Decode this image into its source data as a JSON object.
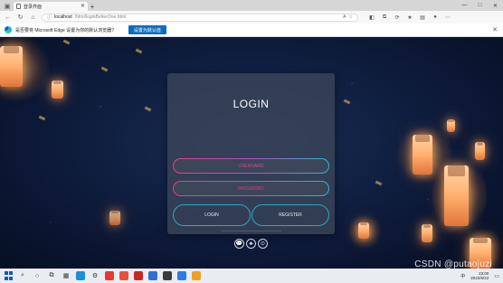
{
  "browser": {
    "tab_title": "登录界面",
    "new_tab": "+",
    "url_host": "localhost",
    "url_path": "/html/loginBetterOne.html",
    "window_controls": [
      "—",
      "□",
      "✕"
    ]
  },
  "infobar": {
    "message": "是否要将 Microsoft Edge 设置为你的默认浏览器?",
    "button": "设置为默认值"
  },
  "login": {
    "title": "LOGIN",
    "username_placeholder": "USERNAME",
    "password_placeholder": "PASSWORD",
    "login_button": "LOGIN",
    "register_button": "REGISTER",
    "social_icons": [
      "wechat-icon",
      "qq-icon",
      "github-icon"
    ]
  },
  "taskbar": {
    "time": "23:00",
    "date": "2022/6/22",
    "lang": "中"
  },
  "watermark": "CSDN @putaojuzi",
  "colors": {
    "accent_pink": "#ec3a8f",
    "accent_cyan": "#2bb8d6",
    "edge_button": "#0f6cbd"
  }
}
